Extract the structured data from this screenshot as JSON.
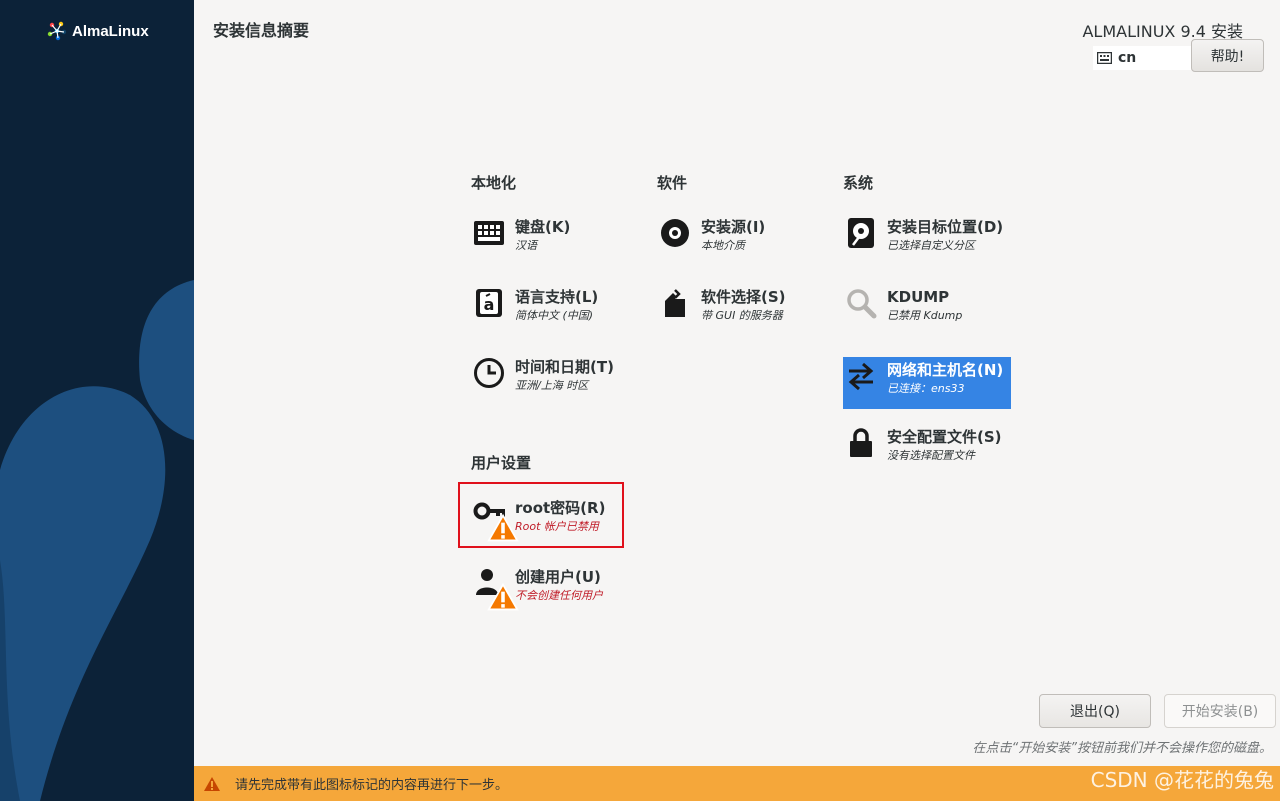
{
  "sidebar": {
    "brand_name": "AlmaLinux"
  },
  "header": {
    "page_title": "安装信息摘要",
    "product_title": "ALMALINUX 9.4 安装",
    "keyboard_layout": "cn",
    "help_label": "帮助!"
  },
  "categories": {
    "localization": "本地化",
    "software": "软件",
    "system": "系统",
    "user_settings": "用户设置"
  },
  "spokes": {
    "keyboard": {
      "name": "键盘(K)",
      "status": "汉语"
    },
    "language": {
      "name": "语言支持(L)",
      "status": "简体中文 (中国)"
    },
    "time": {
      "name": "时间和日期(T)",
      "status": "亚洲/上海 时区"
    },
    "source": {
      "name": "安装源(I)",
      "status": "本地介质"
    },
    "software_selection": {
      "name": "软件选择(S)",
      "status": "带 GUI 的服务器"
    },
    "destination": {
      "name": "安装目标位置(D)",
      "status": "已选择自定义分区"
    },
    "kdump": {
      "name": "KDUMP",
      "status": "已禁用 Kdump"
    },
    "network": {
      "name": "网络和主机名(N)",
      "status": "已连接：ens33"
    },
    "security": {
      "name": "安全配置文件(S)",
      "status": "没有选择配置文件"
    },
    "root": {
      "name": "root密码(R)",
      "status": "Root 帐户已禁用"
    },
    "user": {
      "name": "创建用户(U)",
      "status": "不会创建任何用户"
    }
  },
  "footer": {
    "quit_label": "退出(Q)",
    "begin_label": "开始安装(B)",
    "note": "在点击“开始安装”按钮前我们并不会操作您的磁盘。",
    "warning": "请先完成带有此图标标记的内容再进行下一步。",
    "watermark": "CSDN @花花的兔兔"
  },
  "colors": {
    "sidebar_bg": "#0c2238",
    "selected_bg": "#3584e4",
    "warning_bar": "#f5a73a",
    "warning_text": "#c01c28",
    "highlight_box": "#e0101b"
  },
  "icons": {
    "keyboard": "keyboard-icon",
    "language": "language-icon",
    "time": "clock-icon",
    "source": "disc-icon",
    "software_selection": "package-icon",
    "destination": "disk-icon",
    "kdump": "search-icon",
    "network": "network-arrows-icon",
    "security": "lock-icon",
    "root": "key-icon",
    "user": "user-icon",
    "warning": "warning-icon"
  }
}
